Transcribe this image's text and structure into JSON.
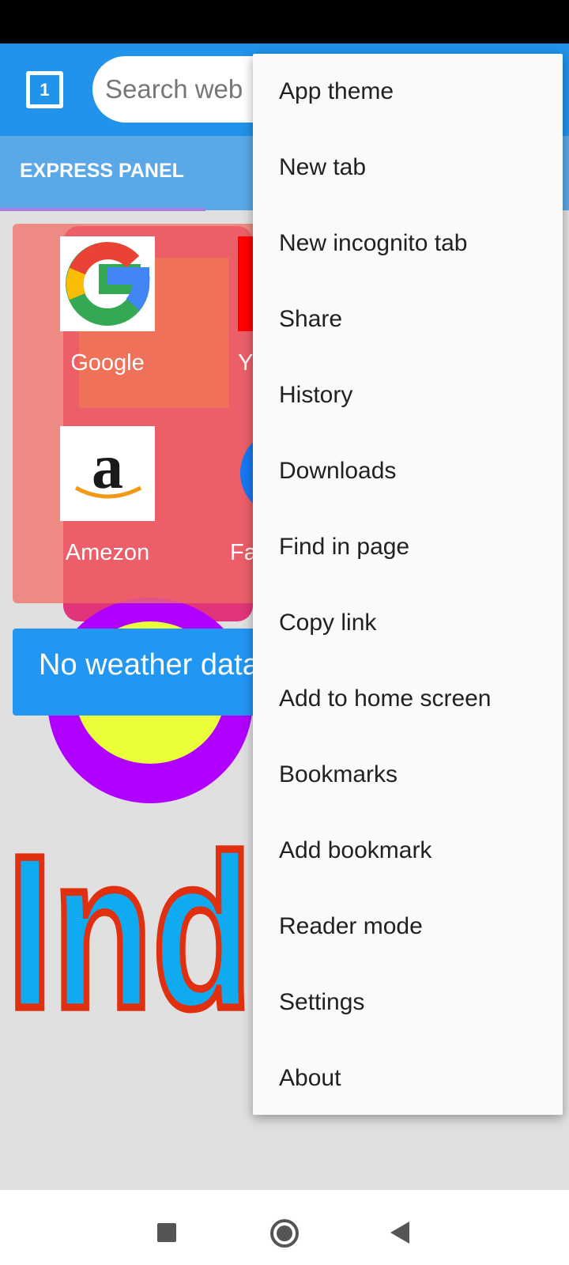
{
  "toolbar": {
    "tab_count": "1",
    "search_placeholder": "Search web"
  },
  "express_panel": {
    "label": "EXPRESS PANEL"
  },
  "speed_dial": [
    {
      "label": "Google",
      "icon": "google-logo"
    },
    {
      "label": "Y",
      "icon": "youtube-logo"
    },
    {
      "label": "Amezon",
      "icon": "amazon-logo"
    },
    {
      "label": "Fa",
      "icon": "facebook-logo"
    }
  ],
  "weather": {
    "text": "No weather data"
  },
  "background_text": "Indian",
  "menu": {
    "items": [
      "App theme",
      "New tab",
      "New incognito tab",
      "Share",
      "History",
      "Downloads",
      "Find in page",
      "Copy link",
      "Add to home screen",
      "Bookmarks",
      "Add bookmark",
      "Reader mode",
      "Settings",
      "About"
    ]
  },
  "colors": {
    "toolbar": "#2193ea",
    "express_bar": "#5aa8e8",
    "weather": "#2196F3"
  }
}
